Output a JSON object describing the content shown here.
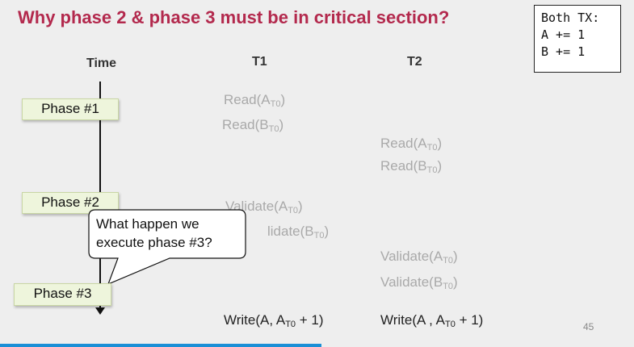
{
  "title": "Why phase 2 & phase 3 must be in critical section?",
  "tx_box": {
    "lines": [
      "Both TX:",
      "A += 1",
      "B += 1"
    ]
  },
  "columns": {
    "time": "Time",
    "t1": "T1",
    "t2": "T2"
  },
  "phases": {
    "p1": "Phase #1",
    "p2": "Phase #2",
    "p3": "Phase #3"
  },
  "callout": {
    "line1": "What happen we",
    "line2": "execute phase #3?"
  },
  "t1": {
    "read_a": {
      "label": "Read(A",
      "sub": "T0",
      "close": ")"
    },
    "read_b": {
      "label": "Read(B",
      "sub": "T0",
      "close": ")"
    },
    "validate_a": {
      "label": "Validate(A",
      "sub": "T0",
      "close": ")"
    },
    "validate_b": {
      "label": "lidate(B",
      "sub": "T0",
      "close": ")"
    },
    "write": {
      "label": "Write(A, A",
      "sub": "T0",
      "close": " + 1)"
    }
  },
  "t2": {
    "read_a": {
      "label": "Read(A",
      "sub": "T0",
      "close": ")"
    },
    "read_b": {
      "label": "Read(B",
      "sub": "T0",
      "close": ")"
    },
    "validate_a": {
      "label": "Validate(A",
      "sub": "T0",
      "close": ")"
    },
    "validate_b": {
      "label": "Validate(B",
      "sub": "T0",
      "close": ")"
    },
    "write": {
      "label": "Write(A , A",
      "sub": "T0",
      "close": " + 1)"
    }
  },
  "page_number": "45"
}
